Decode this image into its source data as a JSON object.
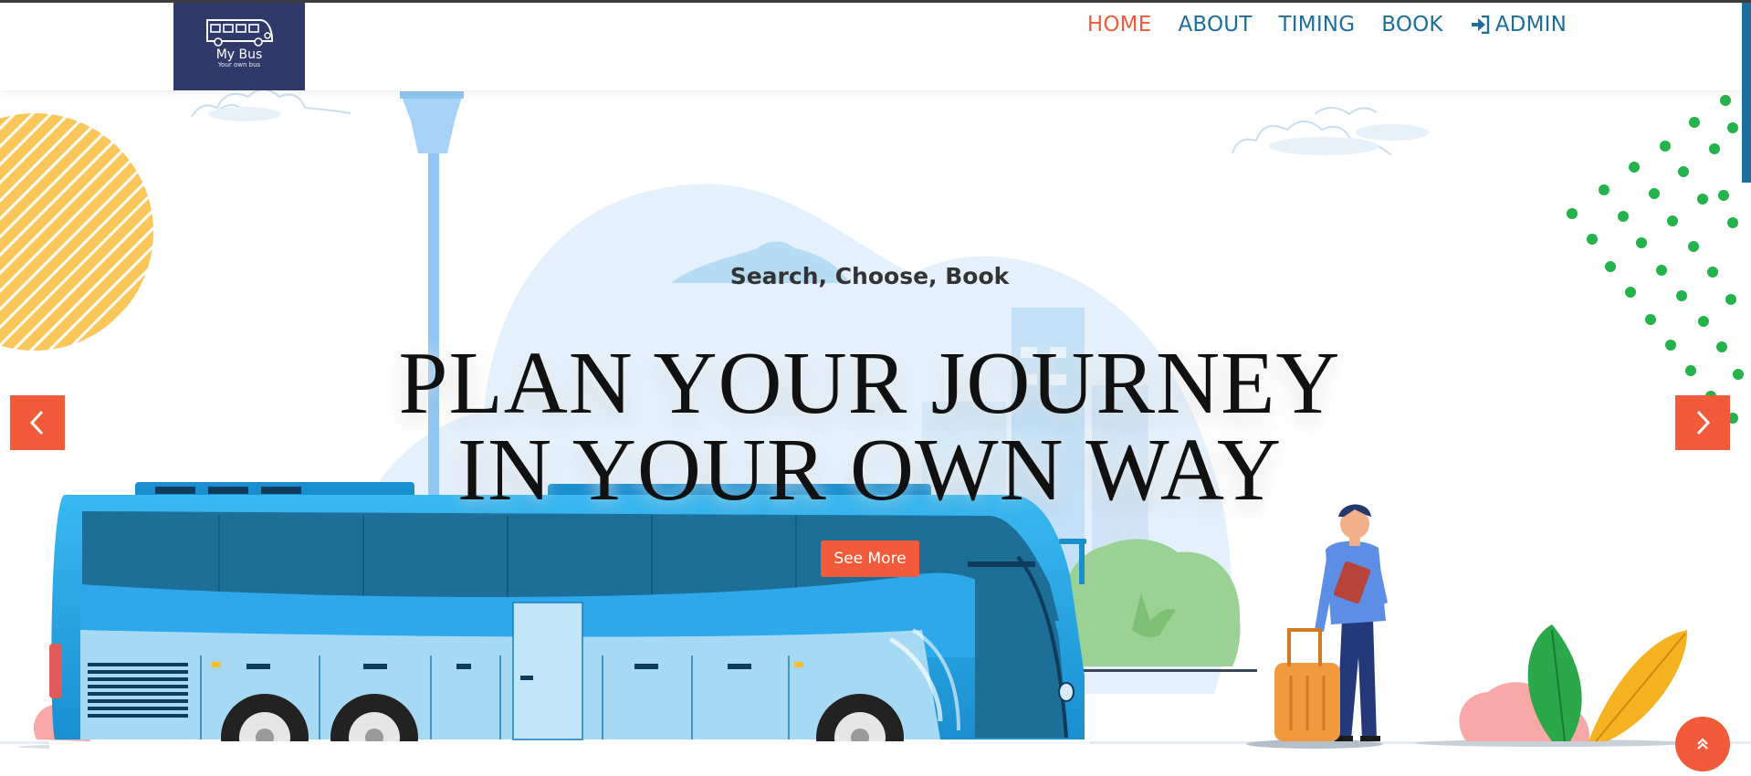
{
  "brand": {
    "name": "My Bus",
    "tagline": "Your own bus",
    "icon": "bus-icon"
  },
  "nav": {
    "items": [
      {
        "label": "HOME",
        "active": true
      },
      {
        "label": "ABOUT",
        "active": false
      },
      {
        "label": "TIMING",
        "active": false
      },
      {
        "label": "BOOK",
        "active": false
      },
      {
        "label": "ADMIN",
        "active": false,
        "icon": "sign-in-icon"
      }
    ]
  },
  "hero": {
    "subtitle": "Search, Choose, Book",
    "headline_line1": "PLAN YOUR JOURNEY",
    "headline_line2": "IN YOUR OWN WAY",
    "cta_label": "See More"
  },
  "carousel": {
    "prev_icon": "chevron-left-icon",
    "next_icon": "chevron-right-icon"
  },
  "scroll_top_icon": "double-chevron-up-icon",
  "colors": {
    "accent": "#f25b3a",
    "nav_link": "#1c6e9c",
    "logo_bg": "#2f3a6b",
    "bus_blue": "#29b0ef"
  }
}
